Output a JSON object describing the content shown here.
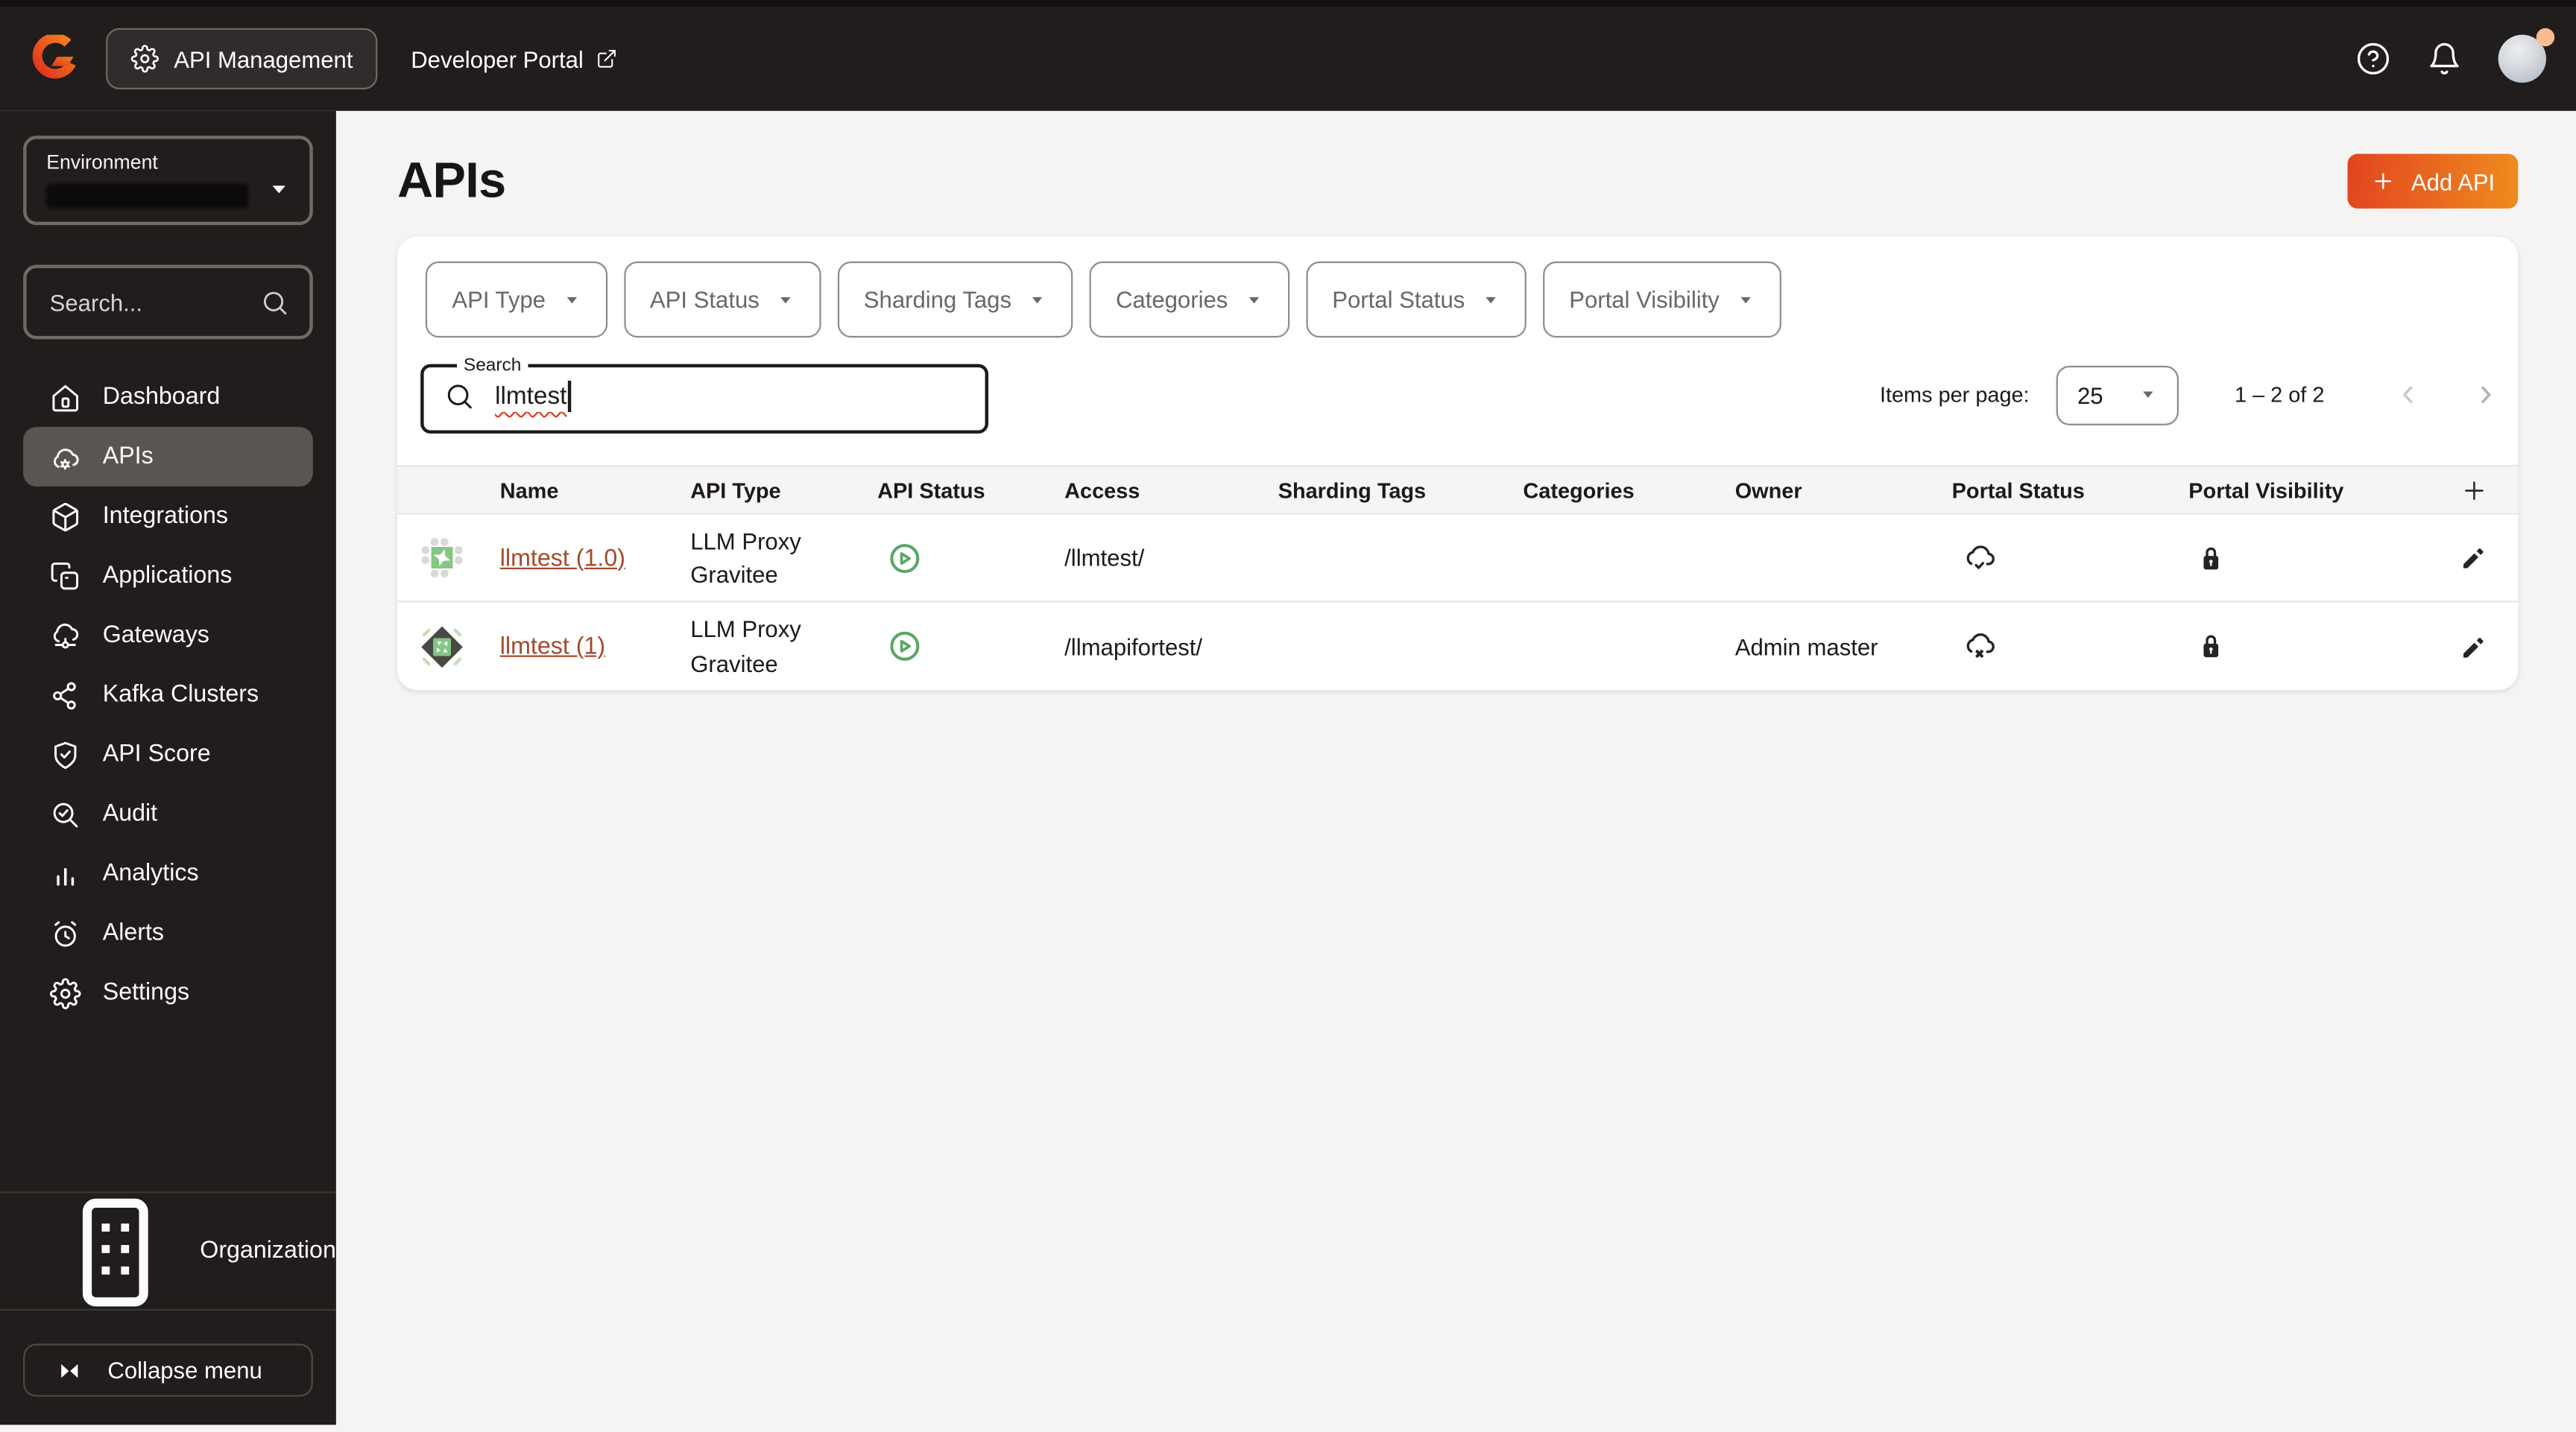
{
  "colors": {
    "topbar_bg": "#201d1c",
    "accent_gradient_start": "#e2451f",
    "accent_gradient_end": "#ef8c1f",
    "link": "#a6492b",
    "status_green": "#58a766",
    "selected_item_bg": "#5a5553",
    "page_bg": "#f6f4f3"
  },
  "topbar": {
    "app_label": "API Management",
    "portal_label": "Developer Portal"
  },
  "sidebar": {
    "environment_label": "Environment",
    "search_placeholder": "Search...",
    "items": [
      {
        "label": "Dashboard"
      },
      {
        "label": "APIs",
        "selected": true
      },
      {
        "label": "Integrations"
      },
      {
        "label": "Applications"
      },
      {
        "label": "Gateways"
      },
      {
        "label": "Kafka Clusters"
      },
      {
        "label": "API Score"
      },
      {
        "label": "Audit"
      },
      {
        "label": "Analytics"
      },
      {
        "label": "Alerts"
      },
      {
        "label": "Settings"
      }
    ],
    "organization_label": "Organization",
    "collapse_label": "Collapse menu"
  },
  "page": {
    "title": "APIs",
    "add_api_label": "Add API",
    "filters": [
      {
        "label": "API Type"
      },
      {
        "label": "API Status"
      },
      {
        "label": "Sharding Tags"
      },
      {
        "label": "Categories"
      },
      {
        "label": "Portal Status"
      },
      {
        "label": "Portal Visibility"
      }
    ],
    "search": {
      "label": "Search",
      "value": "llmtest"
    },
    "pagination": {
      "items_per_page_label": "Items per page:",
      "page_size": "25",
      "range_label": "1 – 2 of 2"
    },
    "table": {
      "columns": [
        {
          "label": "Name"
        },
        {
          "label": "API Type"
        },
        {
          "label": "API Status"
        },
        {
          "label": "Access"
        },
        {
          "label": "Sharding Tags"
        },
        {
          "label": "Categories"
        },
        {
          "label": "Owner"
        },
        {
          "label": "Portal Status"
        },
        {
          "label": "Portal Visibility"
        }
      ],
      "rows": [
        {
          "name": "llmtest (1.0)",
          "api_type": "LLM Proxy Gravitee",
          "api_status": "started",
          "access": "/llmtest/",
          "sharding_tags": "",
          "categories": "",
          "owner": "",
          "portal_status": "published",
          "portal_visibility": "private"
        },
        {
          "name": "llmtest (1)",
          "api_type": "LLM Proxy Gravitee",
          "api_status": "started",
          "access": "/llmapifortest/",
          "sharding_tags": "",
          "categories": "",
          "owner": "Admin master",
          "portal_status": "unpublished",
          "portal_visibility": "private"
        }
      ]
    }
  }
}
